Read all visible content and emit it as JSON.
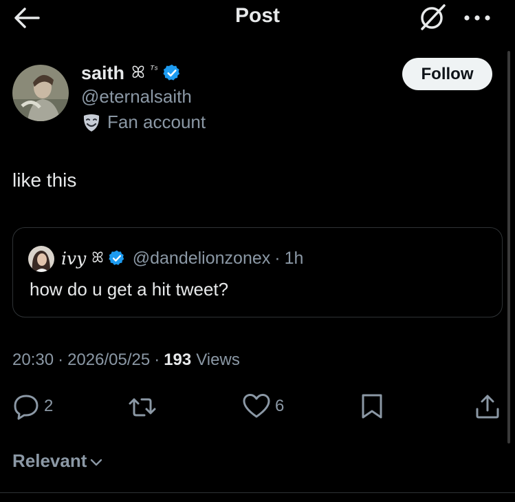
{
  "header": {
    "title": "Post",
    "back_icon": "arrow-left-icon",
    "grok_icon": "grok-icon",
    "more_icon": "more-horizontal-icon"
  },
  "author": {
    "name": "saith",
    "name_symbol": "ꕤ",
    "name_mark": "ᵀˢ",
    "handle": "@eternalsaith",
    "label_icon": "theater-mask-icon",
    "label": "Fan account",
    "follow_label": "Follow"
  },
  "post": {
    "text": "like this"
  },
  "quote": {
    "name": "ivy",
    "name_symbol": "ꕤ",
    "handle": "@dandelionzonex",
    "separator": "·",
    "time": "1h",
    "text": "how do u get a hit tweet?"
  },
  "meta": {
    "time": "20:30",
    "date": "2026/05/25",
    "separator": "·",
    "views_count": "193",
    "views_label": "Views"
  },
  "actions": {
    "reply_count": "2",
    "retweet_count": "",
    "like_count": "6"
  },
  "replies_sort": {
    "label": "Relevant"
  },
  "colors": {
    "background": "#000000",
    "text_primary": "#e7e9ea",
    "text_secondary": "#8b98a5",
    "verified_blue": "#1d9bf0",
    "border": "#2f3336"
  }
}
